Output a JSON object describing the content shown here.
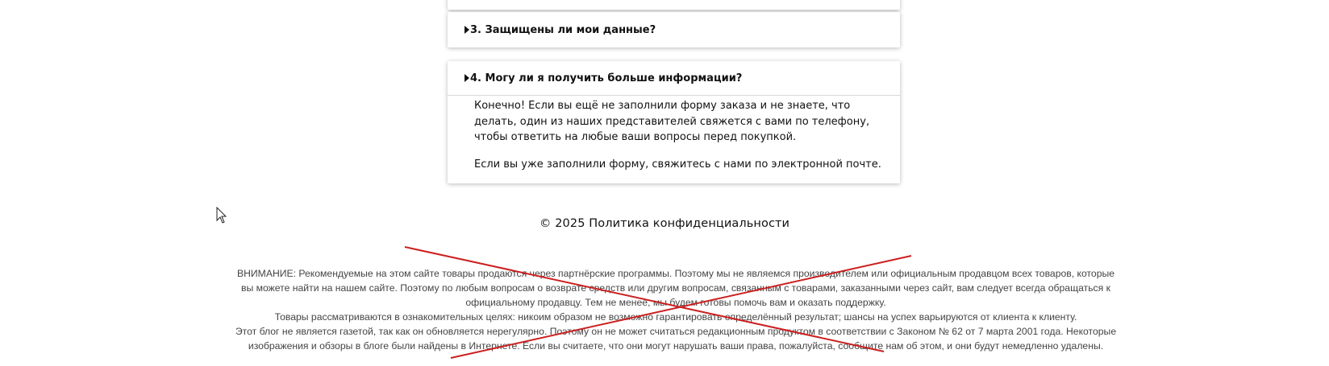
{
  "faq": {
    "q3": {
      "title": "3. Защищены ли мои данные?"
    },
    "q4": {
      "title": "4. Могу ли я получить больше информации?",
      "paragraph1": "Конечно! Если вы ещё не заполнили форму заказа и не знаете, что делать, один из наших представителей свяжется с вами по телефону, чтобы ответить на любые ваши вопросы перед покупкой.",
      "paragraph2": "Если вы уже заполнили форму, свяжитесь с нами по электронной почте."
    }
  },
  "footer": {
    "copyright_year": "© 2025",
    "privacy_link": "Политика конфиденциальности",
    "disclaimer_1": "ВНИМАНИЕ: Рекомендуемые на этом сайте товары продаются через партнёрские программы. Поэтому мы не являемся производителем или официальным продавцом всех товаров, которые вы можете найти на нашем сайте. Поэтому по любым вопросам о возврате средств или другим вопросам, связанным с товарами, заказанными через сайт, вам следует всегда обращаться к официальному продавцу. Тем не менее, мы будем готовы помочь вам и оказать поддержку.",
    "disclaimer_2": "Товары рассматриваются в ознакомительных целях: никоим образом не возможно гарантировать определённый результат; шансы на успех варьируются от клиента к клиенту.",
    "disclaimer_3": "Этот блог не является газетой, так как он обновляется нерегулярно. Поэтому он не может считаться редакционным продуктом в соответствии с Законом № 62 от 7 марта 2001 года. Некоторые изображения и обзоры в блоге были найдены в Интернете. Если вы считаете, что они могут нарушать ваши права, пожалуйста, сообщите нам об этом, и они будут немедленно удалены."
  },
  "colors": {
    "cross_mark": "#cc1f1f",
    "disclaimer_text": "#444444"
  },
  "icons": {
    "cursor": "mouse-pointer-icon",
    "faq_arrow": "caret-right-icon"
  }
}
